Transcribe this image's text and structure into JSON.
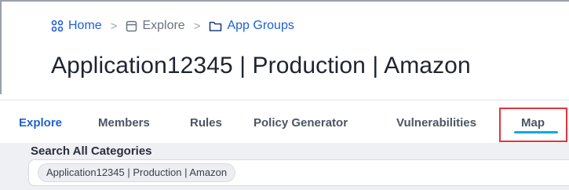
{
  "breadcrumb": {
    "items": [
      {
        "label": "Home",
        "icon": "grid-icon"
      },
      {
        "label": "Explore",
        "icon": "window-icon"
      },
      {
        "label": "App Groups",
        "icon": "folder-icon"
      }
    ],
    "separator": ">"
  },
  "page": {
    "title": "Application12345 | Production | Amazon"
  },
  "tabs": [
    {
      "label": "Explore",
      "active": true
    },
    {
      "label": "Members",
      "active": false
    },
    {
      "label": "Rules",
      "active": false
    },
    {
      "label": "Policy Generator",
      "active": false
    },
    {
      "label": "Vulnerabilities",
      "active": false
    },
    {
      "label": "Map",
      "active": false,
      "highlighted": true
    }
  ],
  "search": {
    "label": "Search All Categories",
    "chip": "Application12345 | Production | Amazon"
  },
  "colors": {
    "link": "#1f5fd6",
    "active_tab": "#2160d3",
    "underline": "#11a8e6",
    "highlight": "#e0353b"
  }
}
